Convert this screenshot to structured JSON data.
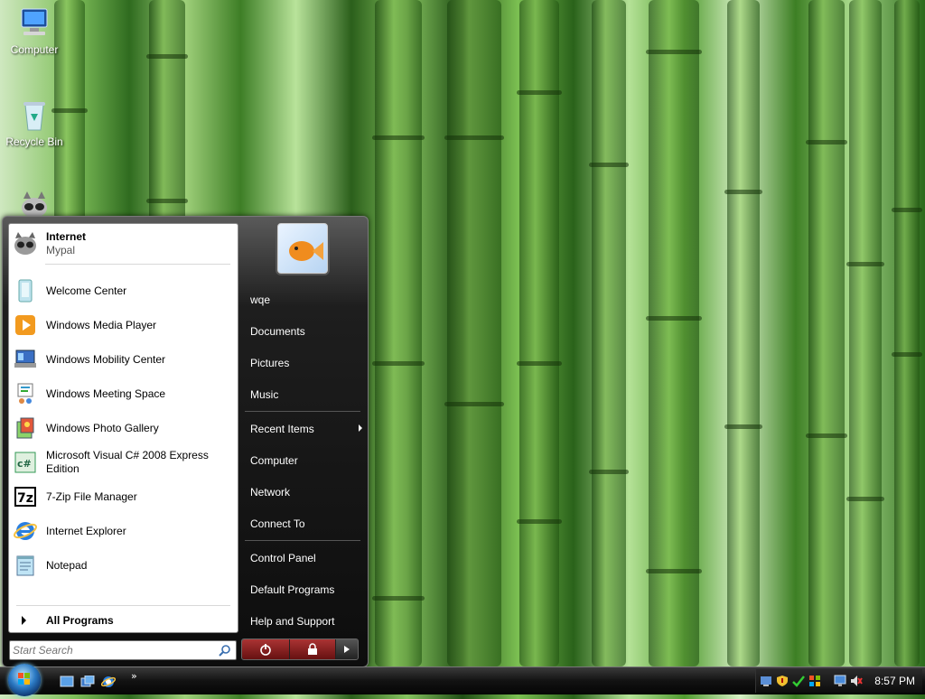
{
  "desktop": {
    "icons": [
      {
        "label": "Computer",
        "icon": "computer-icon"
      },
      {
        "label": "Recycle Bin",
        "icon": "recycle-bin-icon"
      },
      {
        "label": "",
        "icon": "mypal-raccoon-icon"
      }
    ]
  },
  "start_menu": {
    "pinned": {
      "title": "Internet",
      "subtitle": "Mypal",
      "icon": "mypal-raccoon-icon"
    },
    "programs": [
      {
        "label": "Welcome Center",
        "icon": "welcome-center-icon"
      },
      {
        "label": "Windows Media Player",
        "icon": "media-player-icon"
      },
      {
        "label": "Windows Mobility Center",
        "icon": "mobility-center-icon"
      },
      {
        "label": "Windows Meeting Space",
        "icon": "meeting-space-icon"
      },
      {
        "label": "Windows Photo Gallery",
        "icon": "photo-gallery-icon"
      },
      {
        "label": "Microsoft Visual C# 2008 Express Edition",
        "icon": "visual-csharp-icon"
      },
      {
        "label": "7-Zip File Manager",
        "icon": "seven-zip-icon"
      },
      {
        "label": "Internet Explorer",
        "icon": "internet-explorer-icon"
      },
      {
        "label": "Notepad",
        "icon": "notepad-icon"
      }
    ],
    "all_programs": "All Programs",
    "search": {
      "placeholder": "Start Search",
      "value": ""
    },
    "right": {
      "user": "wqe",
      "items_top": [
        "Documents",
        "Pictures",
        "Music"
      ],
      "recent_items": "Recent Items",
      "items_mid": [
        "Computer",
        "Network",
        "Connect To"
      ],
      "items_bottom": [
        "Control Panel",
        "Default Programs",
        "Help and Support"
      ]
    },
    "power": {
      "power_icon": "power-icon",
      "lock_icon": "lock-icon",
      "options_icon": "arrow-right-icon"
    }
  },
  "taskbar": {
    "quick_launch": [
      "show-desktop-icon",
      "switch-windows-icon",
      "internet-explorer-icon"
    ],
    "overflow_chevron": "»",
    "tray_icons": [
      "network-icon",
      "security-shield-icon",
      "update-icon",
      "windows-update-icon",
      "display-icon",
      "volume-muted-icon"
    ],
    "clock": "8:57 PM"
  },
  "colors": {
    "accent": "#2c7bc5",
    "wallpaper_green": "#3e7e26"
  }
}
